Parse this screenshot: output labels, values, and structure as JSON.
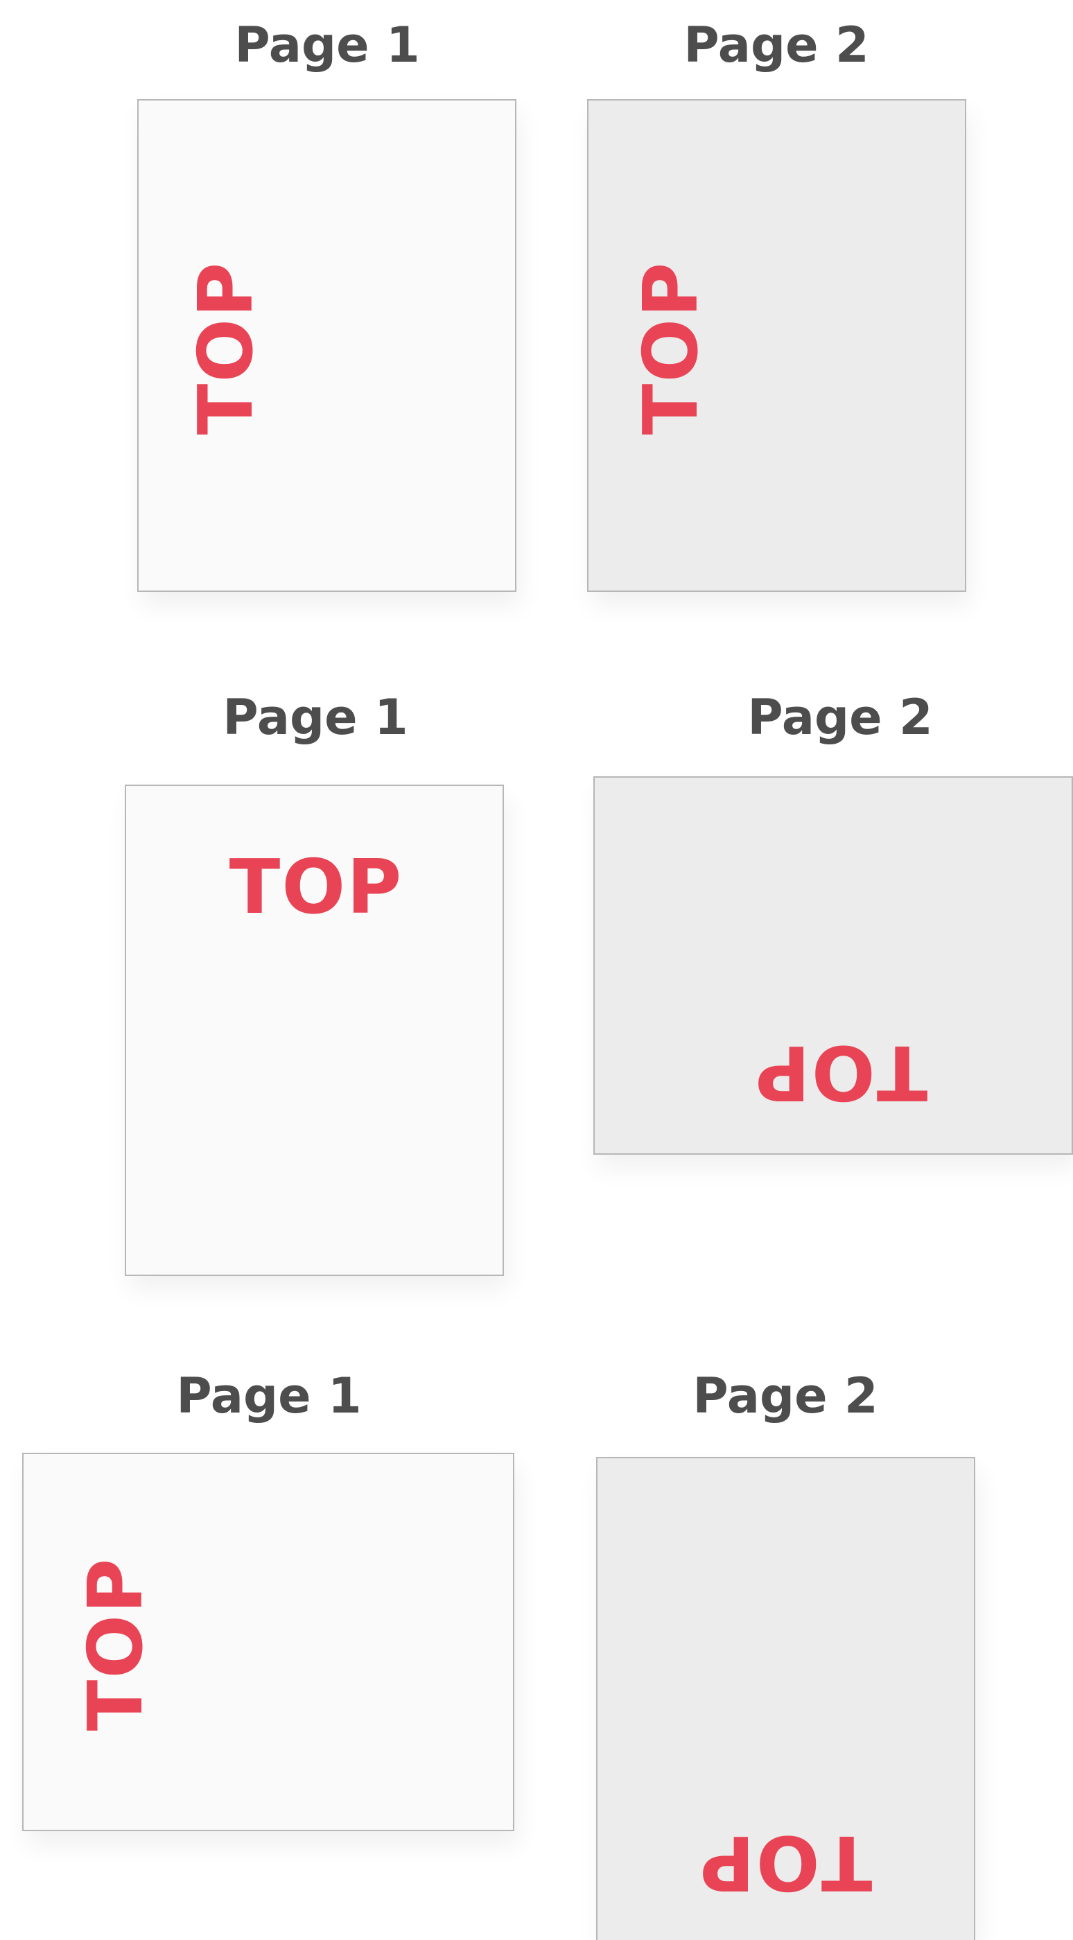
{
  "mark_color": "#e84455",
  "label_color": "#4d4d4d",
  "front_sheet_color": "#fafafa",
  "back_sheet_color": "#ececec",
  "rows": [
    {
      "page1": {
        "label": "Page 1",
        "mark": "TOP",
        "mark_orientation": "rotated 90° counter-clockwise"
      },
      "page2": {
        "label": "Page 2",
        "mark": "TOP",
        "mark_orientation": "rotated 90° counter-clockwise"
      }
    },
    {
      "page1": {
        "label": "Page 1",
        "mark": "TOP",
        "mark_orientation": "upright"
      },
      "page2": {
        "label": "Page 2",
        "mark": "TOP",
        "mark_orientation": "rotated 180°"
      }
    },
    {
      "page1": {
        "label": "Page 1",
        "mark": "TOP",
        "mark_orientation": "rotated 90° counter-clockwise"
      },
      "page2": {
        "label": "Page 2",
        "mark": "TOP",
        "mark_orientation": "rotated 180°"
      }
    }
  ]
}
